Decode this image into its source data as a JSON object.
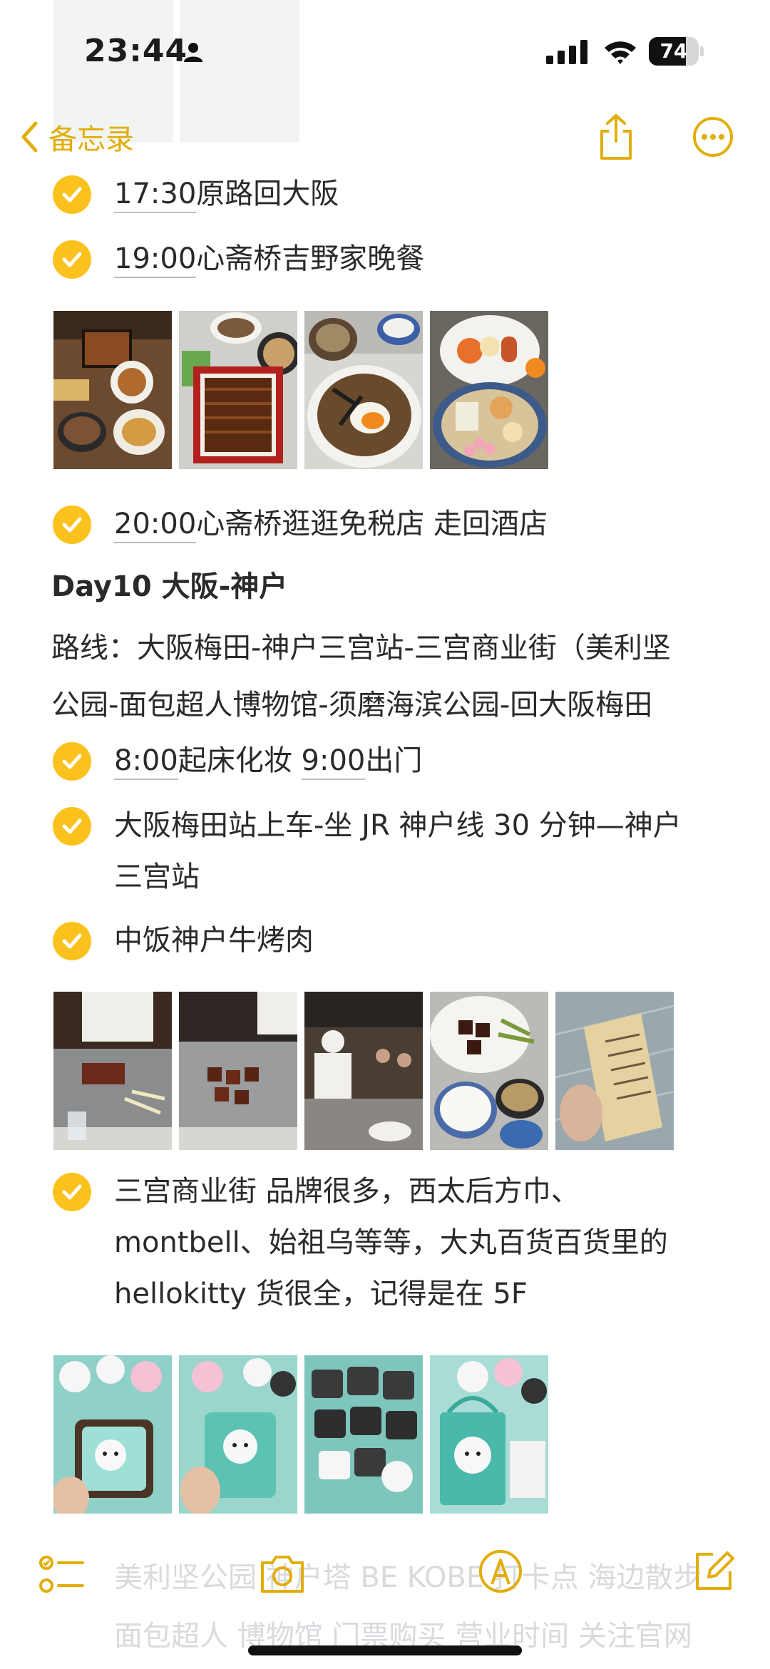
{
  "status_bar": {
    "time": "23:44",
    "battery_level": "74",
    "battery_fraction": 0.74,
    "icons": [
      "person-icon",
      "cellular-signal-icon",
      "wifi-icon",
      "battery-icon"
    ]
  },
  "nav": {
    "back_label": "备忘录",
    "back_icon": "chevron-left-icon",
    "share_icon": "share-icon",
    "more_icon": "more-icon"
  },
  "colors": {
    "accent": "#e2ad08",
    "checkbox": "#fbc21d",
    "text": "#2a2a2a"
  },
  "note": {
    "items": [
      {
        "time": "17:30",
        "text": "原路回大阪"
      },
      {
        "time": "19:00",
        "text": "心斋桥吉野家晚餐"
      },
      {
        "time": "20:00",
        "text": "心斋桥逛逛免税店 走回酒店"
      }
    ],
    "day_heading": "Day10 大阪-神户",
    "route_line1": "路线：大阪梅田-神户三宫站-三宫商业街（美利坚",
    "route_line2": "公园-面包超人博物馆-须磨海滨公园-回大阪梅田",
    "morning": {
      "time1": "8:00",
      "text1": "起床化妆 ",
      "time2": "9:00",
      "text2": "出门"
    },
    "train_line1": "大阪梅田站上车-坐 JR 神户线 30 分钟—神户",
    "train_line2": "三宫站",
    "lunch": "中饭神户牛烤肉",
    "shopping_line1": "三宫商业街 品牌很多，西太后方巾、",
    "shopping_line2": "montbell、始祖乌等等，大丸百货百货里的",
    "shopping_line3": "hellokitty 货很全，记得是在 5F",
    "hidden_line1": "美利坚公园 神户塔 BE KOBE 打卡点 海边散步",
    "hidden_line2": "面包超人 博物馆 门票购买 营业时间 关注官网"
  },
  "photos": {
    "dinner": [
      "beef-bowl-set-photo",
      "unagi-don-photo",
      "rice-bowl-egg-photo",
      "oden-plate-photo"
    ],
    "teppanyaki": [
      "teppanyaki-chef-photo",
      "grilled-beef-photo",
      "restaurant-counter-photo",
      "steak-meal-photo",
      "receipt-photo"
    ],
    "hellokitty": [
      "kitty-pouch-photo",
      "kitty-bag-photo",
      "kitty-tins-photo",
      "kitty-tote-photo"
    ]
  },
  "toolbar": {
    "checklist_icon": "checklist-icon",
    "camera_icon": "camera-icon",
    "markup_icon": "markup-pen-icon",
    "compose_icon": "compose-icon"
  }
}
